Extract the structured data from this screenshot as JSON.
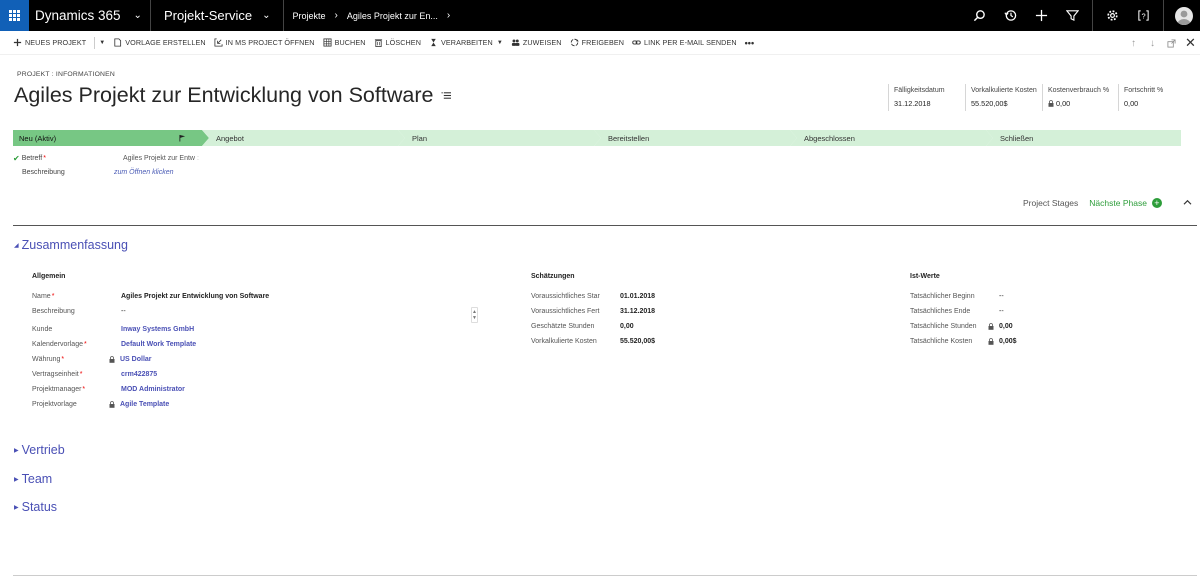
{
  "topnav": {
    "app_name": "Dynamics 365",
    "area": "Projekt-Service",
    "crumbs": [
      "Projekte",
      "Agiles Projekt zur En..."
    ]
  },
  "commands": [
    {
      "label": "NEUES PROJEKT",
      "icon": "plus-icon"
    },
    {
      "label": "VORLAGE ERSTELLEN",
      "icon": "page-icon"
    },
    {
      "label": "IN MS PROJECT ÖFFNEN",
      "icon": "import-icon"
    },
    {
      "label": "BUCHEN",
      "icon": "grid-icon"
    },
    {
      "label": "LÖSCHEN",
      "icon": "trash-icon"
    },
    {
      "label": "VERARBEITEN",
      "icon": "hourglass-icon"
    },
    {
      "label": "ZUWEISEN",
      "icon": "people-icon"
    },
    {
      "label": "FREIGEBEN",
      "icon": "share-icon"
    },
    {
      "label": "LINK PER E-MAIL SENDEN",
      "icon": "link-icon"
    },
    {
      "label": "•••",
      "icon": "more-icon"
    }
  ],
  "header": {
    "entity_label": "PROJEKT : INFORMATIONEN",
    "title": "Agiles Projekt zur Entwicklung von Software",
    "fields": [
      {
        "label": "Fälligkeitsdatum",
        "value": "31.12.2018",
        "locked": false
      },
      {
        "label": "Vorkalkulierte Kosten",
        "value": "55.520,00$",
        "locked": false
      },
      {
        "label": "Kostenverbrauch %",
        "value": "0,00",
        "locked": true
      },
      {
        "label": "Fortschritt %",
        "value": "0,00",
        "locked": false
      }
    ]
  },
  "process": {
    "stages": [
      "Neu (Aktiv)",
      "Angebot",
      "Plan",
      "Bereitstellen",
      "Abgeschlossen",
      "Schließen"
    ],
    "active_index": 0,
    "colors": {
      "active": "#77c784",
      "inactive": "#d4f0d8"
    },
    "step_fields": [
      {
        "label": "Betreff",
        "value": "Agiles Projekt zur Entw",
        "required": true,
        "checked": true
      },
      {
        "label": "Beschreibung",
        "value": "zum Öffnen klicken",
        "required": false,
        "checked": false
      }
    ],
    "project_stages_label": "Project Stages",
    "next_phase_label": "Nächste Phase"
  },
  "summary": {
    "title": "Zusammenfassung",
    "general_title": "Allgemein",
    "general": [
      {
        "label": "Name",
        "value": "Agiles Projekt zur Entwicklung von Software",
        "required": true,
        "link": false,
        "locked": false
      },
      {
        "label": "Beschreibung",
        "value": "--",
        "required": false,
        "link": false,
        "locked": false
      },
      {
        "label": "Kunde",
        "value": "Inway Systems GmbH",
        "required": false,
        "link": true,
        "locked": false
      },
      {
        "label": "Kalendervorlage",
        "value": "Default Work Template",
        "required": true,
        "link": true,
        "locked": false
      },
      {
        "label": "Währung",
        "value": "US Dollar",
        "required": true,
        "link": true,
        "locked": true
      },
      {
        "label": "Vertragseinheit",
        "value": "crm422875",
        "required": true,
        "link": true,
        "locked": false
      },
      {
        "label": "Projektmanager",
        "value": "MOD Administrator",
        "required": true,
        "link": true,
        "locked": false
      },
      {
        "label": "Projektvorlage",
        "value": "Agile Template",
        "required": false,
        "link": true,
        "locked": true
      }
    ],
    "estimates_title": "Schätzungen",
    "estimates": [
      {
        "label": "Voraussichtliches Star",
        "value": "01.01.2018"
      },
      {
        "label": "Voraussichtliches Fert",
        "value": "31.12.2018"
      },
      {
        "label": "Geschätzte Stunden",
        "value": "0,00"
      },
      {
        "label": "Vorkalkulierte Kosten",
        "value": "55.520,00$"
      }
    ],
    "actuals_title": "Ist-Werte",
    "actuals": [
      {
        "label": "Tatsächlicher Beginn",
        "value": "--",
        "locked": false
      },
      {
        "label": "Tatsächliches Ende",
        "value": "--",
        "locked": false
      },
      {
        "label": "Tatsächliche Stunden",
        "value": "0,00",
        "locked": true
      },
      {
        "label": "Tatsächliche Kosten",
        "value": "0,00$",
        "locked": true
      }
    ]
  },
  "sections": [
    "Vertrieb",
    "Team",
    "Status"
  ]
}
